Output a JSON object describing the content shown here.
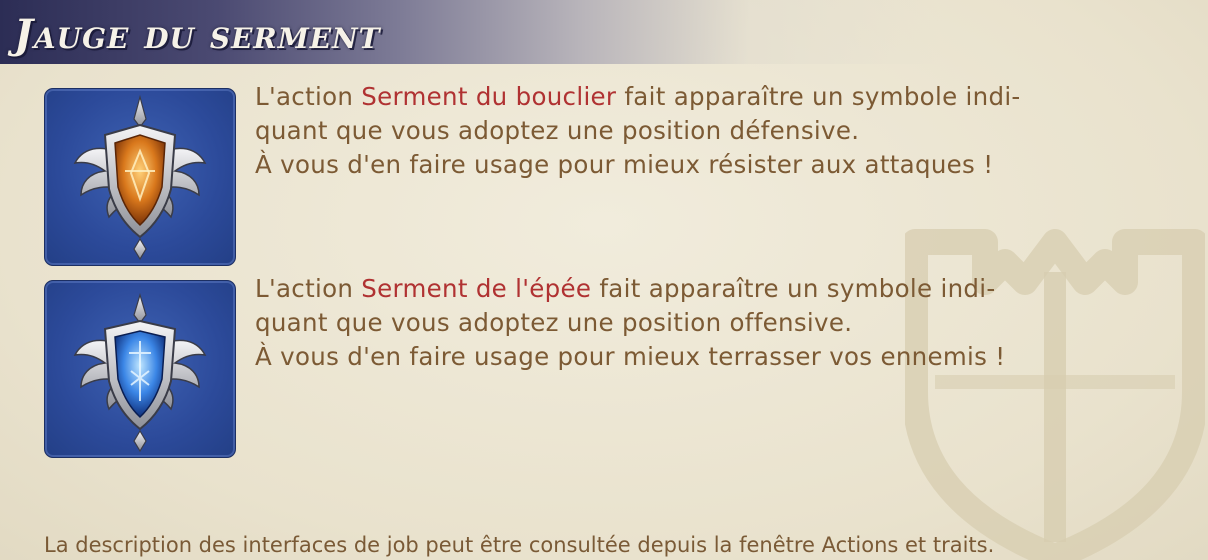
{
  "panel": {
    "title": "Jauge du serment",
    "footer": "La description des interfaces de job peut être consultée depuis la fenêtre Actions et traits."
  },
  "entries": [
    {
      "icon": "shield-oath-icon",
      "prefix": "L'action ",
      "keyword": "Serment du bouclier",
      "line1_rest": " fait apparaître un symbole indi-",
      "line2": "quant que vous adoptez une position défensive.",
      "line3": "À vous d'en faire usage pour mieux résister aux attaques !"
    },
    {
      "icon": "sword-oath-icon",
      "prefix": "L'action ",
      "keyword": "Serment de l'épée",
      "line1_rest": " fait apparaître un symbole indi-",
      "line2": "quant que vous adoptez une position offensive.",
      "line3": "À vous d'en faire usage pour mieux terrasser vos ennemis !"
    }
  ],
  "colors": {
    "keyword": "#b03232",
    "body_text": "#7c5a34",
    "icon_background": "#2c4a9a",
    "header_dark": "#2c2d55"
  },
  "decor": {
    "watermark": "paladin-crest-icon"
  }
}
